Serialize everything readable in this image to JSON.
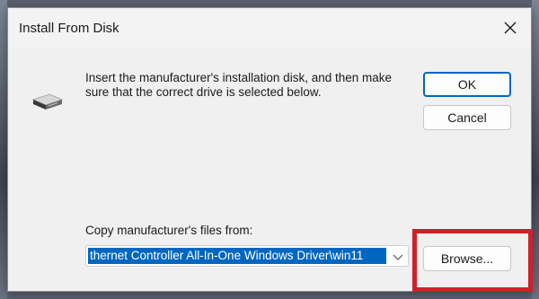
{
  "dialog": {
    "title": "Install From Disk",
    "close_icon": "close-icon",
    "disk_icon": "disk-drive-icon",
    "instruction": "Insert the manufacturer's installation disk, and then make sure that the correct drive is selected below.",
    "ok_label": "OK",
    "cancel_label": "Cancel",
    "copy_label": "Copy manufacturer's files from:",
    "path_value": "thernet Controller All-In-One Windows Driver\\win11",
    "browse_label": "Browse...",
    "highlight_color": "#d0202a",
    "accent_color": "#0067c0"
  }
}
